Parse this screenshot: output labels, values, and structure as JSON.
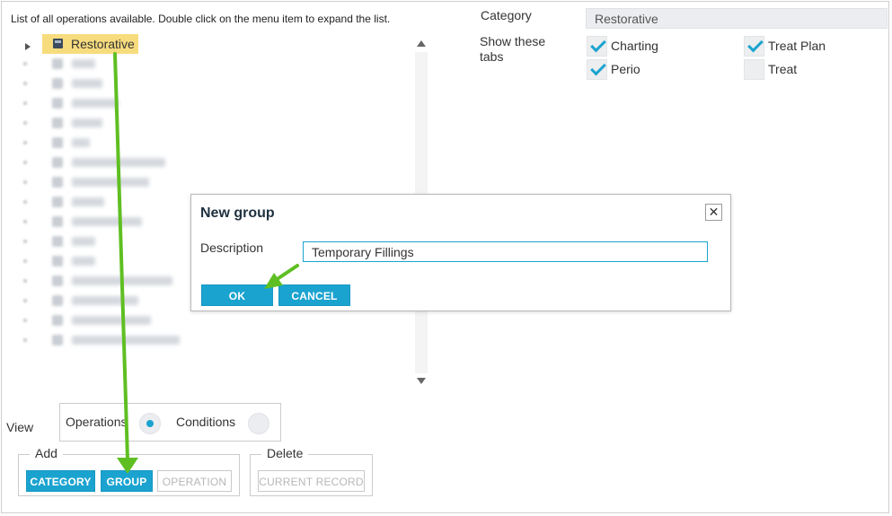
{
  "instructions": "List of all operations available. Double click on the menu item to expand the list.",
  "tree": {
    "root_label": "Restorative",
    "blurred_item_count_note": ""
  },
  "details": {
    "category_label": "Category",
    "category_value": "Restorative",
    "tabs_label": "Show these tabs",
    "tabs": [
      {
        "label": "Charting",
        "checked": true
      },
      {
        "label": "Treat Plan",
        "checked": true
      },
      {
        "label": "Perio",
        "checked": true
      },
      {
        "label": "Treat",
        "checked": false
      }
    ]
  },
  "view": {
    "label": "View",
    "options": [
      {
        "label": "Operations",
        "selected": true
      },
      {
        "label": "Conditions",
        "selected": false
      }
    ]
  },
  "add": {
    "legend": "Add",
    "category_button": "CATEGORY",
    "group_button": "GROUP",
    "operation_button": "OPERATION"
  },
  "delete": {
    "legend": "Delete",
    "current_record_button": "CURRENT RECORD"
  },
  "modal": {
    "title": "New group",
    "close_icon": "close-icon",
    "description_label": "Description",
    "description_value": "Temporary Fillings",
    "ok_button": "OK",
    "cancel_button": "CANCEL"
  },
  "colors": {
    "accent": "#1ba3d0",
    "selection": "#f7dc7e",
    "annotation_arrow": "#5fbf22"
  }
}
